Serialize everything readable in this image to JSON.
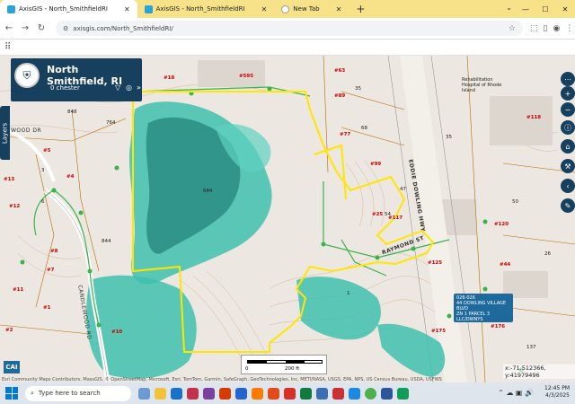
{
  "browser": {
    "tabs": [
      {
        "label": "AxisGIS - North_SmithfieldRI",
        "active": true
      },
      {
        "label": "AxisGIS - North_SmithfieldRI",
        "active": false
      },
      {
        "label": "New Tab",
        "active": false
      }
    ],
    "url": "axisgis.com/North_SmithfieldRI/"
  },
  "header": {
    "title": "North Smithfield, RI",
    "search_value": "0 chester"
  },
  "layers_tab": "Layers",
  "tooltip": {
    "lines": [
      "026-026",
      "44 DOWLING VILLAGE BLVD",
      "ZN 1 PARCEL 3 LLC/DWNYS"
    ]
  },
  "coordinates": "x:-71.512366, y:41979496",
  "attribution": "Esri Community Maps Contributors, MassGIS, © OpenStreetMap, Microsoft, Esri, TomTom, Garmin, SafeGraph, GeoTechnologies, Inc, METI/NASA, USGS, EPA, NPS, US Census Bureau, USDA, USFWS",
  "brand": "CAI",
  "scalebar": {
    "start": "0",
    "end": "200 ft"
  },
  "streets": {
    "eddie_dowling": "EDDIE DOWLING HWY",
    "raymond": "RAYMOND ST",
    "candlewood": "CANDLEWOOD RD",
    "lakewood": "WOOD DR"
  },
  "map_labels": {
    "rehab": "Rehabilitation Hospital of Rhode Island",
    "parcels": [
      "#595",
      "#18",
      "#63",
      "#77",
      "#89",
      "#99",
      "#117",
      "#25",
      "#125",
      "#118",
      "#120",
      "#44",
      "#176",
      "#175",
      "#4",
      "#13",
      "#12",
      "#7",
      "#8",
      "#5",
      "#11",
      "#10",
      "#1",
      "#2"
    ],
    "numbers": [
      "848",
      "764",
      "844",
      "684",
      "54",
      "50",
      "35",
      "68",
      "26",
      "137",
      "3",
      "6",
      "1",
      "47",
      "35"
    ]
  },
  "taskbar": {
    "search_placeholder": "Type here to search",
    "time": "12:45 PM",
    "date": "4/3/2025"
  },
  "colors": {
    "header_bg": "#17405f",
    "wetland": "#3fbfae",
    "wetland_dark": "#2c8f86",
    "parcel_outline": "#ffe600",
    "parcel_line": "#b86b00",
    "trail": "#3bb34a"
  }
}
